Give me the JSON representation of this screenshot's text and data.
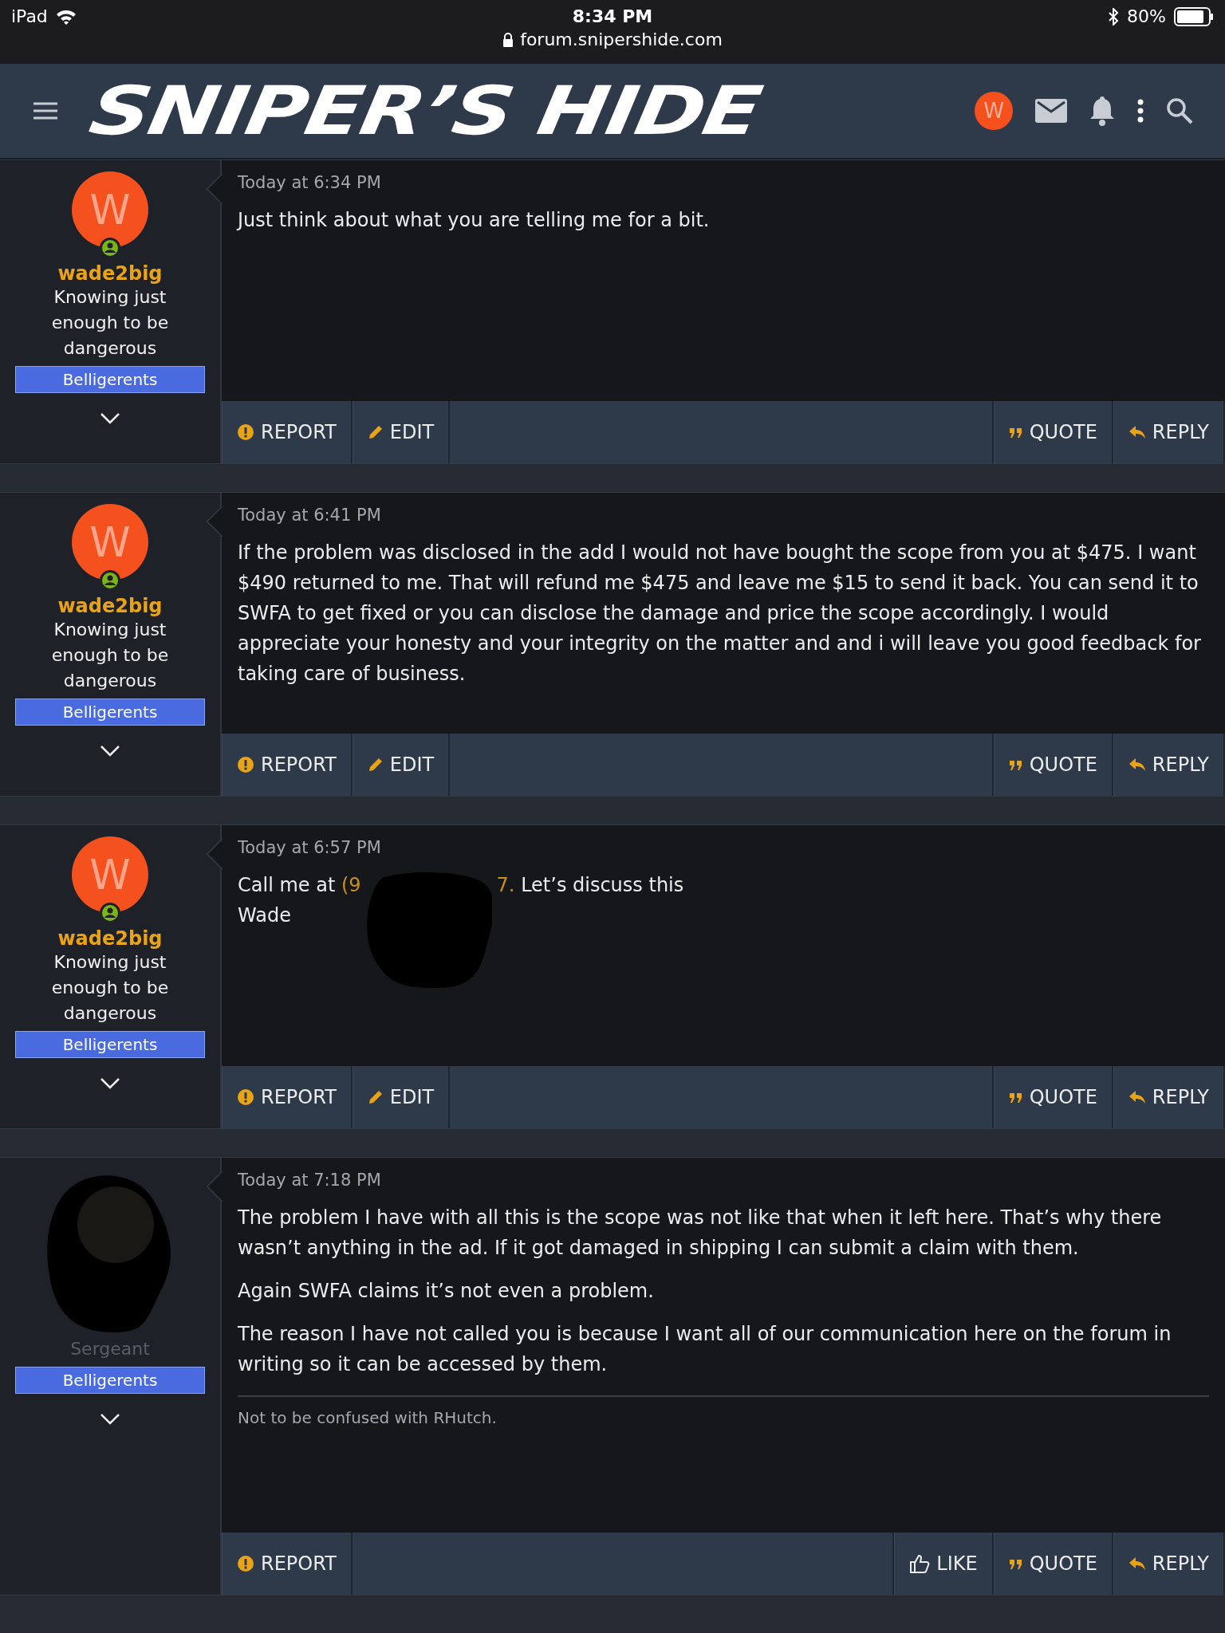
{
  "status_bar": {
    "device": "iPad",
    "time": "8:34 PM",
    "url": "forum.snipershide.com",
    "battery": "80%"
  },
  "header": {
    "logo": "SNIPER’S HIDE",
    "avatar_letter": "W"
  },
  "posts": [
    {
      "author": {
        "kind": "avatar",
        "letter": "W",
        "username": "wade2big",
        "title": "Knowing just enough to be dangerous",
        "banner": "Belligerents"
      },
      "time": "Today at 6:34 PM",
      "paragraphs": [
        {
          "segments": [
            {
              "kind": "text",
              "text": "Just think about what you are telling me for a bit."
            }
          ]
        }
      ],
      "actions": [
        {
          "kind": "report",
          "label": "REPORT"
        },
        {
          "kind": "edit",
          "label": "EDIT"
        },
        {
          "kind": "quote",
          "label": "QUOTE"
        },
        {
          "kind": "reply",
          "label": "REPLY"
        }
      ]
    },
    {
      "author": {
        "kind": "avatar",
        "letter": "W",
        "username": "wade2big",
        "title": "Knowing just enough to be dangerous",
        "banner": "Belligerents"
      },
      "time": "Today at 6:41 PM",
      "paragraphs": [
        {
          "segments": [
            {
              "kind": "text",
              "text": "If the problem was disclosed in the add I would not have bought the scope from you at $475. I want $490 returned to me. That will refund me $475 and leave me $15 to send it back. You can send it to SWFA to get fixed or you can disclose the damage and price the scope accordingly. I would appreciate your honesty and your integrity on the matter and and i will leave you good feedback for taking care of business."
            }
          ]
        }
      ],
      "actions": [
        {
          "kind": "report",
          "label": "REPORT"
        },
        {
          "kind": "edit",
          "label": "EDIT"
        },
        {
          "kind": "quote",
          "label": "QUOTE"
        },
        {
          "kind": "reply",
          "label": "REPLY"
        }
      ]
    },
    {
      "author": {
        "kind": "avatar",
        "letter": "W",
        "username": "wade2big",
        "title": "Knowing just enough to be dangerous",
        "banner": "Belligerents"
      },
      "time": "Today at 6:57 PM",
      "paragraphs": [
        {
          "segments": [
            {
              "kind": "text",
              "text": "Call me at "
            },
            {
              "kind": "link",
              "text": "(9"
            },
            {
              "kind": "redaction"
            },
            {
              "kind": "link",
              "text": "7."
            },
            {
              "kind": "text",
              "text": " Let’s discuss this"
            },
            {
              "kind": "break"
            },
            {
              "kind": "text",
              "text": "Wade"
            }
          ]
        }
      ],
      "actions": [
        {
          "kind": "report",
          "label": "REPORT"
        },
        {
          "kind": "edit",
          "label": "EDIT"
        },
        {
          "kind": "quote",
          "label": "QUOTE"
        },
        {
          "kind": "reply",
          "label": "REPLY"
        }
      ]
    },
    {
      "author": {
        "kind": "redacted",
        "title": "Sergeant",
        "banner": "Belligerents"
      },
      "time": "Today at 7:18 PM",
      "paragraphs": [
        {
          "segments": [
            {
              "kind": "text",
              "text": "The problem I have with all this is the scope was not like that when it left here. That’s why there wasn’t anything in the ad. If it got damaged in shipping I can submit a claim with them."
            }
          ]
        },
        {
          "segments": [
            {
              "kind": "text",
              "text": "Again SWFA claims it’s not even a problem."
            }
          ]
        },
        {
          "segments": [
            {
              "kind": "text",
              "text": "The reason I have not called you is because I want all of our communication here on the forum in writing so it can be accessed by them."
            }
          ]
        }
      ],
      "signature": "Not to be confused with RHutch.",
      "actions": [
        {
          "kind": "report",
          "label": "REPORT"
        },
        {
          "kind": "like",
          "label": "LIKE"
        },
        {
          "kind": "quote",
          "label": "QUOTE"
        },
        {
          "kind": "reply",
          "label": "REPLY"
        }
      ]
    }
  ]
}
